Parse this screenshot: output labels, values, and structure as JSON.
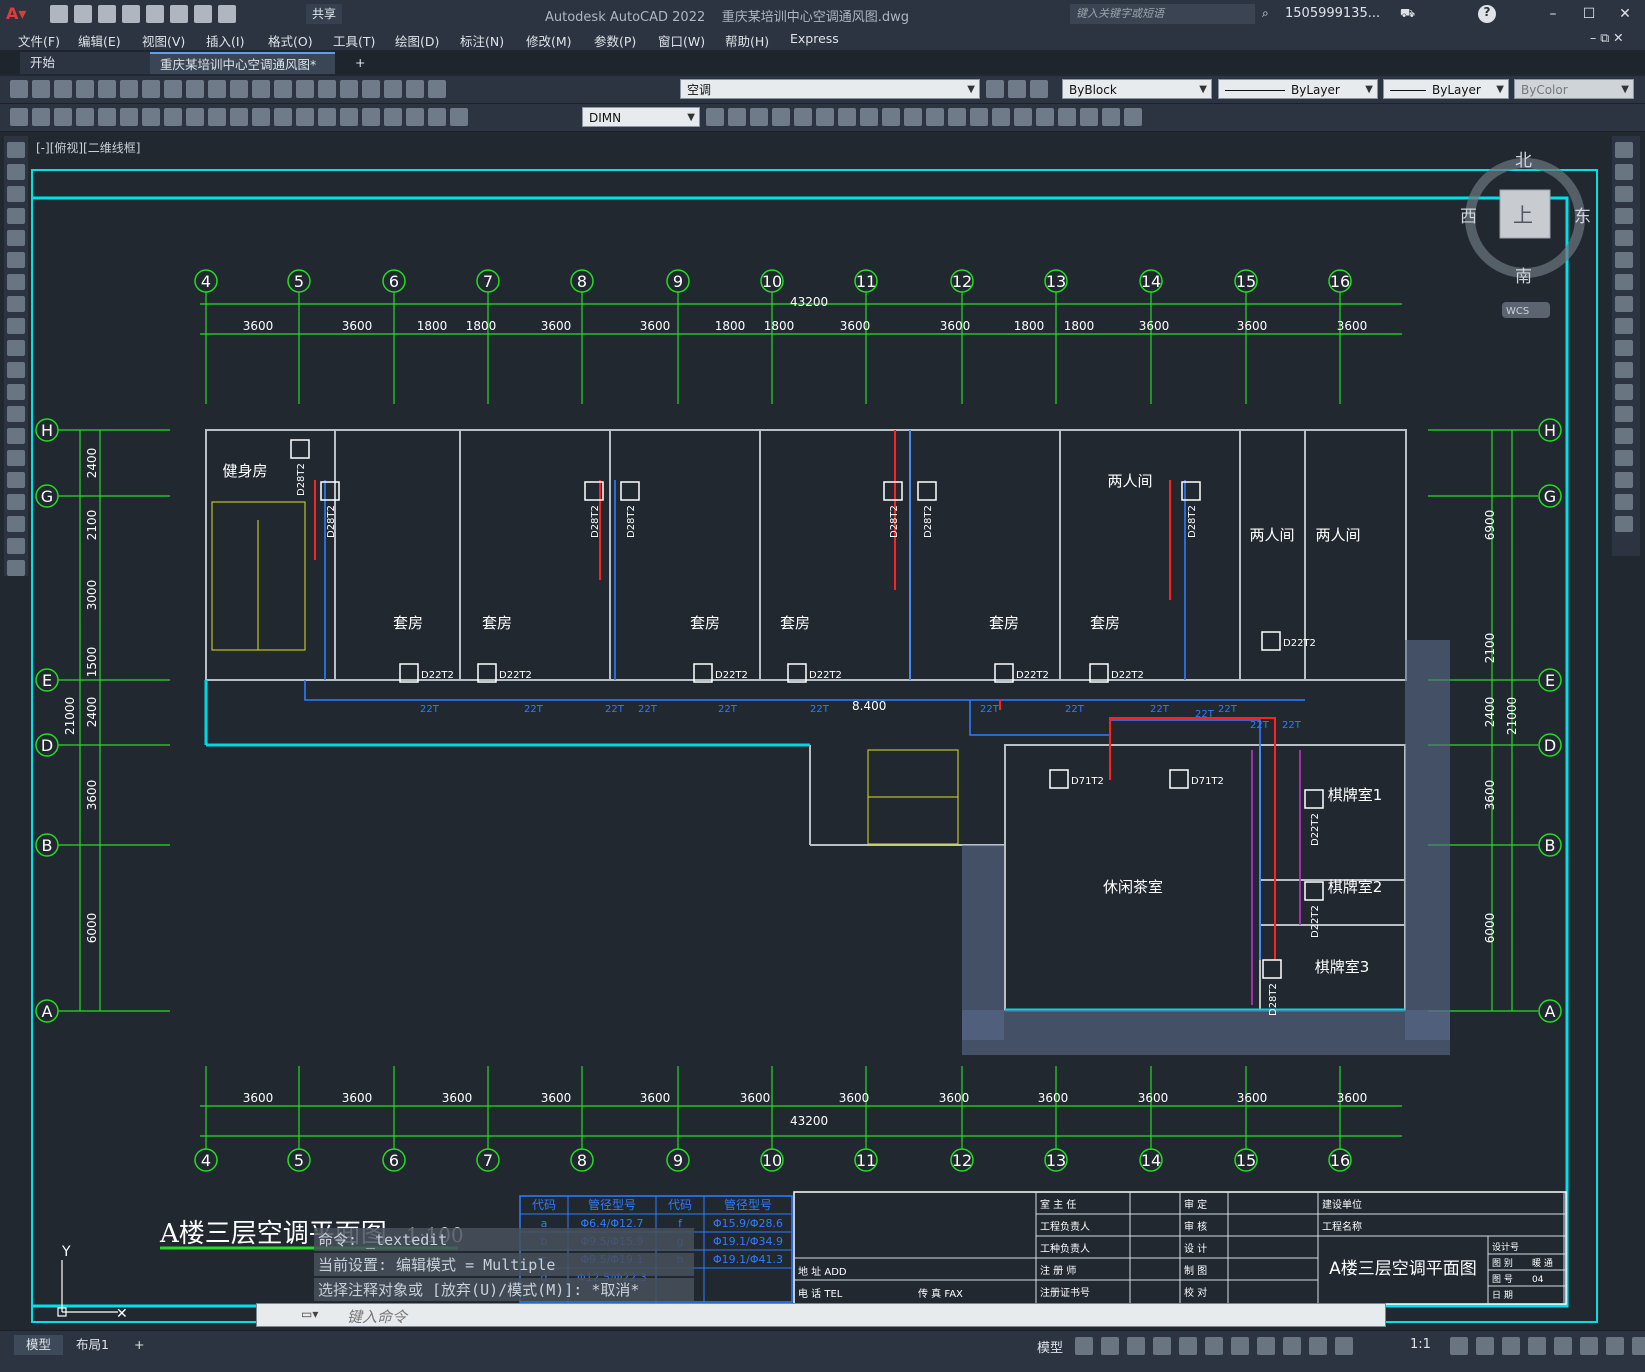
{
  "app": {
    "title": "Autodesk AutoCAD 2022    重庆某培训中心空调通风图.dwg",
    "share_label": "共享",
    "search_placeholder": "键入关键字或短语",
    "user": "1505999135...",
    "help": "?"
  },
  "menu": [
    "文件(F)",
    "编辑(E)",
    "视图(V)",
    "插入(I)",
    "格式(O)",
    "工具(T)",
    "绘图(D)",
    "标注(N)",
    "修改(M)",
    "参数(P)",
    "窗口(W)",
    "帮助(H)",
    "Express"
  ],
  "tabs": {
    "start": "开始",
    "active": "重庆某培训中心空调通风图*",
    "add": "+"
  },
  "toolbar": {
    "layer": "空调",
    "color": "ByBlock",
    "linetype": "ByLayer",
    "lineweight": "ByLayer",
    "plotstyle": "ByColor",
    "dimstyle": "DIMN"
  },
  "viewport_label": "[-][俯视][二维线框]",
  "viewcube": {
    "north": "北",
    "south": "南",
    "east": "东",
    "west": "西",
    "face": "上",
    "wcs": "WCS"
  },
  "grid": {
    "columns": [
      "4",
      "5",
      "6",
      "7",
      "8",
      "9",
      "10",
      "11",
      "12",
      "13",
      "14",
      "15",
      "16"
    ],
    "rows": [
      "H",
      "G",
      "E",
      "D",
      "B",
      "A"
    ],
    "top_total": "43200",
    "bottom_total": "43200",
    "top_spacings": [
      "3600",
      "3600",
      "1800",
      "1800",
      "3600",
      "3600",
      "1800",
      "1800",
      "3600",
      "3600",
      "1800",
      "1800",
      "3600",
      "3600",
      "3600"
    ],
    "bottom_spacings": [
      "3600",
      "3600",
      "3600",
      "3600",
      "3600",
      "3600",
      "3600",
      "3600",
      "3600",
      "3600",
      "3600",
      "3600"
    ],
    "left_spacings": [
      "2400",
      "2100",
      "3000",
      "1500",
      "2400",
      "3600",
      "6000"
    ],
    "left_total": "21000",
    "right_spacings": [
      "6900",
      "2100",
      "2400",
      "3600",
      "6000"
    ],
    "right_total": "21000"
  },
  "rooms": [
    "健身房",
    "套房",
    "套房",
    "套房",
    "套房",
    "套房",
    "套房",
    "两人间",
    "两人间",
    "两人间",
    "休闲茶室",
    "棋牌室1",
    "棋牌室2",
    "棋牌室3"
  ],
  "units": [
    "D22T2",
    "D28T2",
    "D22T2",
    "D22T2",
    "D22T2",
    "D22T2",
    "D22T2",
    "D22T2",
    "D28T2",
    "D28T2",
    "D28T2",
    "D28T2",
    "D28T2",
    "D28T2",
    "D71T2",
    "D71T2",
    "D22T2",
    "D22T2",
    "D28T2"
  ],
  "pipe_labels": [
    "22T",
    "22T",
    "22T",
    "22T",
    "22T",
    "22T",
    "22T",
    "22T",
    "22T",
    "22T",
    "22T",
    "22T",
    "22T"
  ],
  "elevation": "8.400",
  "drawing_title": "A楼三层空调平面图",
  "drawing_scale": "1:100",
  "legend": {
    "headers": [
      "代码",
      "管径型号",
      "代码",
      "管径型号"
    ],
    "rows": [
      [
        "a",
        "Φ6.4/Φ12.7",
        "f",
        "Φ15.9/Φ28.6"
      ],
      [
        "b",
        "Φ9.5/Φ15.9",
        "g",
        "Φ19.1/Φ34.9"
      ],
      [
        "c",
        "Φ9.5/Φ19.1",
        "h",
        "Φ19.1/Φ41.3"
      ],
      [
        "d",
        "Φ12.5/Φ22.3",
        "",
        ""
      ]
    ]
  },
  "titleblock": {
    "left": [
      "地 址 ADD",
      "电 话 TEL",
      "传 真 FAX"
    ],
    "mid": [
      "室 主 任",
      "工程负责人",
      "工种负责人",
      "注 册 师",
      "注册证书号"
    ],
    "right": [
      "审 定",
      "审 核",
      "设 计",
      "制 图",
      "校 对"
    ],
    "far": [
      "建设单位",
      "工程名称"
    ],
    "name": "A楼三层空调平面图",
    "info": [
      "设计号",
      "图 别",
      "图 号",
      "日 期"
    ],
    "info_values": [
      "",
      "暖 通",
      "04",
      ""
    ]
  },
  "command": {
    "history": [
      "命令: _textedit",
      "当前设置: 编辑模式 = Multiple",
      "选择注释对象或 [放弃(U)/模式(M)]: *取消*"
    ],
    "placeholder": "键入命令"
  },
  "status": {
    "model_tab": "模型",
    "layout1": "布局1",
    "add": "+",
    "model_btn": "模型",
    "scale": "1:1"
  },
  "ucs": {
    "y": "Y"
  }
}
